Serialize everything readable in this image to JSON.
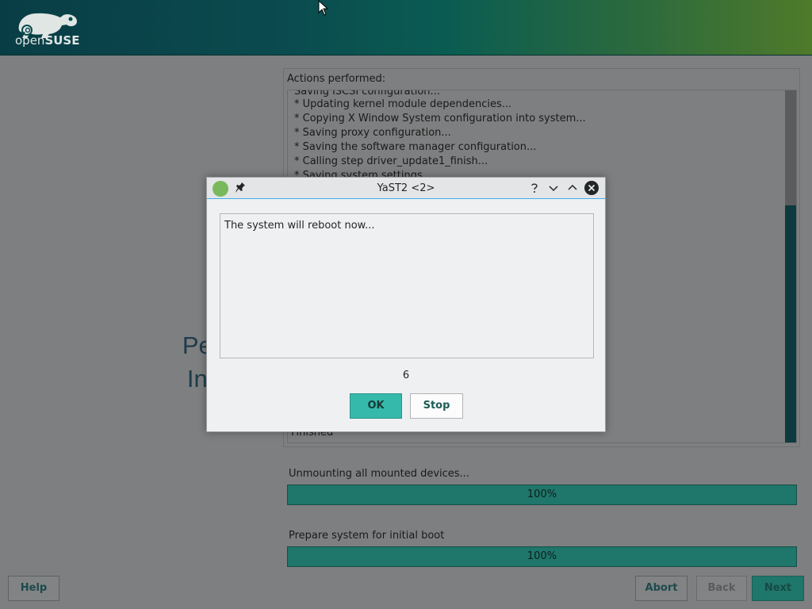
{
  "header": {
    "logo_text_light": "open",
    "logo_text_bold": "SUSE"
  },
  "page": {
    "title_line1": "Perform",
    "title_line2": "Installa"
  },
  "actions": {
    "label": "Actions performed:",
    "log": [
      "Saving iSCSI configuration...",
      "* Updating kernel module dependencies...",
      "* Copying X Window System configuration into system...",
      "* Saving proxy configuration...",
      "* Saving the software manager configuration...",
      "* Calling step driver_update1_finish...",
      "* Saving system settings..."
    ],
    "last_line": "Finished"
  },
  "progress": [
    {
      "label": "Unmounting all mounted devices...",
      "text": "100%",
      "value": 1.0
    },
    {
      "label": "Prepare system for initial boot",
      "text": "100%",
      "value": 1.0
    }
  ],
  "buttons": {
    "help": "Help",
    "abort": "Abort",
    "back": "Back",
    "next": "Next"
  },
  "dialog": {
    "title": "YaST2 <2>",
    "message": "The system will reboot now...",
    "countdown": "6",
    "ok_label": "OK",
    "stop_label": "Stop"
  },
  "colors": {
    "accent": "#35b9ab",
    "focus": "#3daee9",
    "progress_fill": "#1f766a"
  }
}
